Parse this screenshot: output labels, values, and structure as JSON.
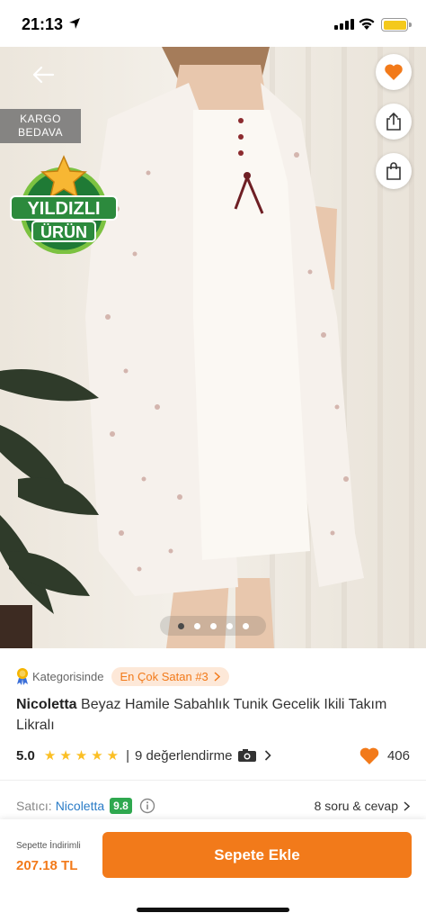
{
  "status_bar": {
    "time": "21:13"
  },
  "hero": {
    "kargo_badge_line1": "KARGO",
    "kargo_badge_line2": "BEDAVA",
    "star_badge_line1": "YILDIZLI",
    "star_badge_line2": "ÜRÜN",
    "carousel": {
      "total": 5,
      "active": 1
    }
  },
  "category": {
    "label": "Kategorisinde",
    "rank": "En Çok Satan #3"
  },
  "product": {
    "brand": "Nicoletta",
    "title": " Beyaz Hamile Sabahlık Tunik Gecelik Ikili Takım Likralı"
  },
  "rating": {
    "score": "5.0",
    "stars": 5,
    "separator": "|",
    "review_text": "9 değerlendirme",
    "favorites": "406"
  },
  "seller": {
    "prefix": "Satıcı:",
    "name": "Nicoletta",
    "score": "9.8",
    "qa_text": "8 soru & cevap"
  },
  "bottom_bar": {
    "discount_label": "Sepette İndirimli",
    "discount_price": "207.18 TL",
    "add_to_cart_label": "Sepete Ekle"
  },
  "colors": {
    "accent": "#f27a1a",
    "seller_link": "#2a7cc7",
    "seller_score_bg": "#2fa84f",
    "star": "#fbbf24"
  }
}
